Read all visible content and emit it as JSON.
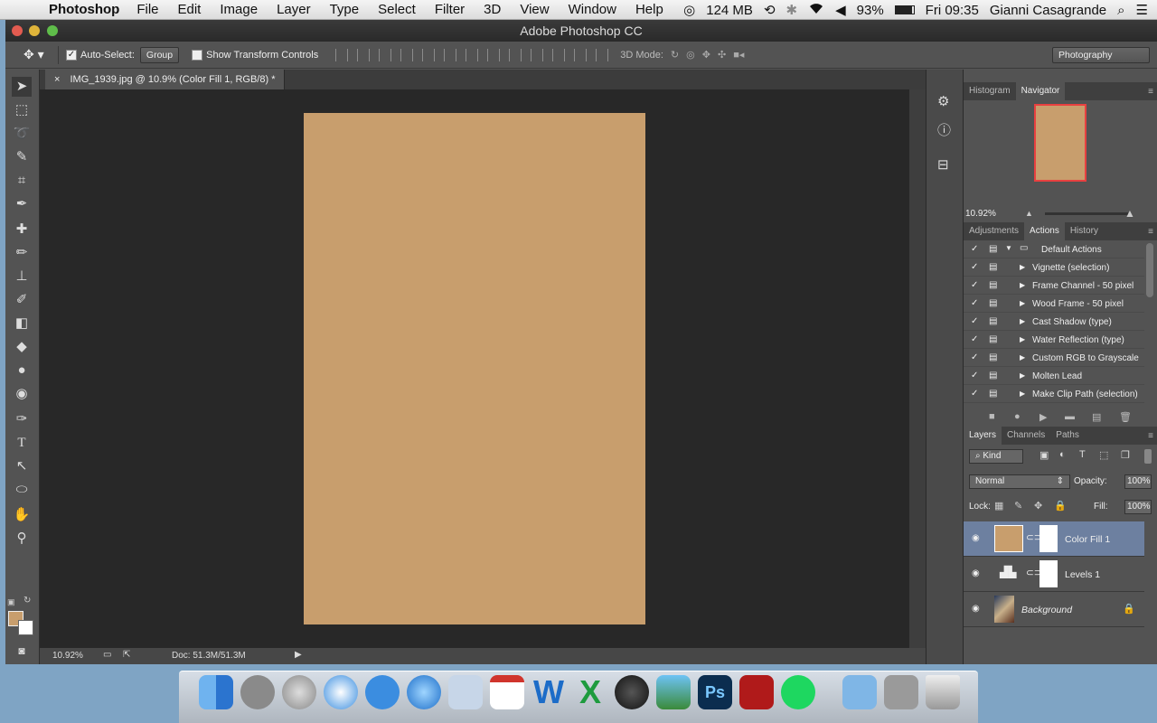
{
  "menubar": {
    "app_name": "Photoshop",
    "menus": [
      "File",
      "Edit",
      "Image",
      "Layer",
      "Type",
      "Select",
      "Filter",
      "3D",
      "View",
      "Window",
      "Help"
    ],
    "memory": "124 MB",
    "battery": "93%",
    "clock": "Fri 09:35",
    "user": "Gianni Casagrande"
  },
  "window": {
    "title": "Adobe Photoshop CC",
    "doc_tab": "IMG_1939.jpg @ 10.9% (Color Fill 1, RGB/8) *"
  },
  "options": {
    "auto_select_label": "Auto-Select:",
    "auto_select_value": "Group",
    "transform_label": "Show Transform Controls",
    "mode_3d": "3D Mode:",
    "workspace": "Photography"
  },
  "status": {
    "zoom": "10.92%",
    "doc": "Doc: 51.3M/51.3M"
  },
  "canvas": {
    "fill_color": "#c89e6d"
  },
  "navigator": {
    "tabs": [
      "Histogram",
      "Navigator"
    ],
    "zoom": "10.92%"
  },
  "actions": {
    "tabs": [
      "Adjustments",
      "Actions",
      "History"
    ],
    "set_name": "Default Actions",
    "items": [
      "Vignette (selection)",
      "Frame Channel - 50 pixel",
      "Wood Frame - 50 pixel",
      "Cast Shadow (type)",
      "Water Reflection (type)",
      "Custom RGB to Grayscale",
      "Molten Lead",
      "Make Clip Path (selection)"
    ]
  },
  "layers": {
    "tabs": [
      "Layers",
      "Channels",
      "Paths"
    ],
    "filter": "Kind",
    "blend_mode": "Normal",
    "opacity_label": "Opacity:",
    "opacity": "100%",
    "lock_label": "Lock:",
    "fill_label": "Fill:",
    "fill": "100%",
    "items": [
      "Color Fill 1",
      "Levels 1",
      "Background"
    ]
  }
}
